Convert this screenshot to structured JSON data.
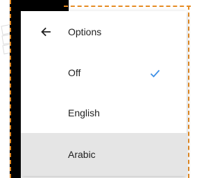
{
  "menu": {
    "title": "Options",
    "back_icon": "arrow-left-icon",
    "items": [
      {
        "label": "Off",
        "selected": true,
        "highlighted": false
      },
      {
        "label": "English",
        "selected": false,
        "highlighted": false
      },
      {
        "label": "Arabic",
        "selected": false,
        "highlighted": true
      }
    ],
    "check_icon": "checkmark-icon"
  },
  "colors": {
    "accent": "#3c8fe6",
    "highlight": "#e5e5e5",
    "text": "#212121",
    "dashed_border": "#e58b23"
  }
}
